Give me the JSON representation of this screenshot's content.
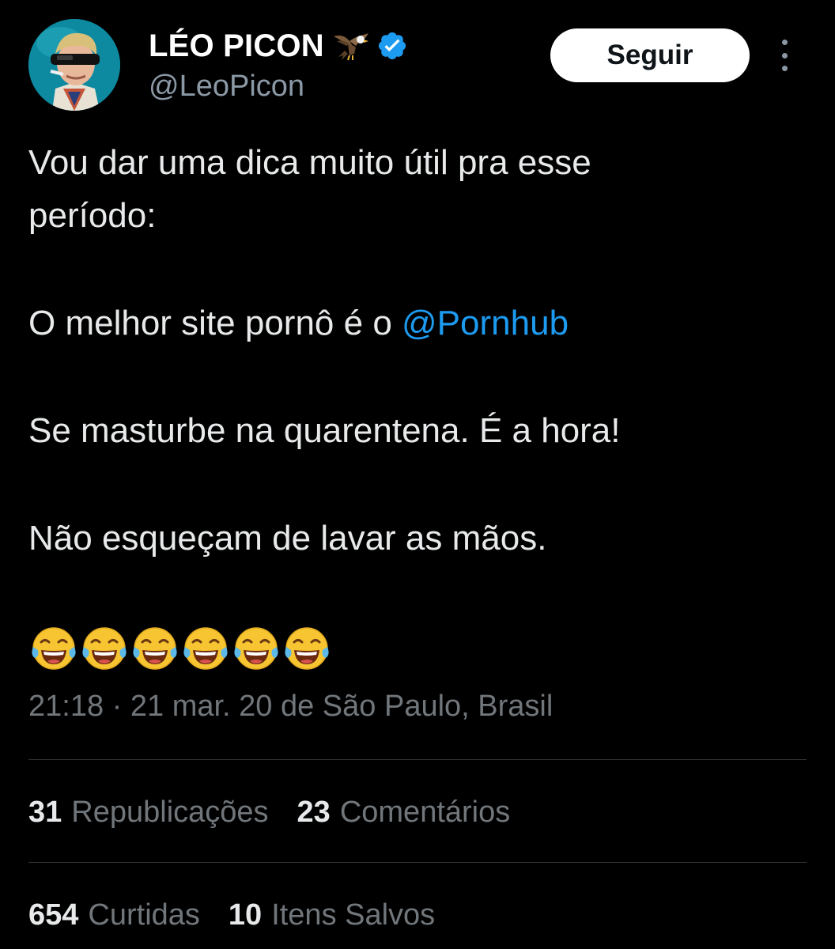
{
  "author": {
    "display_name": "LÉO PICON",
    "handle": "@LeoPicon",
    "badge_emoji": "eagle-icon",
    "verified": true,
    "verified_color": "#1d9bf0"
  },
  "follow_button": {
    "label": "Seguir"
  },
  "tweet": {
    "line1": "Vou dar uma dica muito útil pra esse",
    "line2": "período:",
    "line3_text": "O melhor site pornô é o ",
    "line3_mention": "@Pornhub",
    "line4": "Se masturbe na quarentena. É a hora!",
    "line5": "Não esqueçam de lavar as mãos.",
    "emoji": "😂😂😂😂😂😂",
    "emoji_count": 6
  },
  "timestamp": "21:18 · 21 mar. 20 de São Paulo, Brasil",
  "stats": {
    "reposts_count": "31",
    "reposts_label": "Republicações",
    "comments_count": "23",
    "comments_label": "Comentários",
    "likes_count": "654",
    "likes_label": "Curtidas",
    "saves_count": "10",
    "saves_label": "Itens Salvos"
  },
  "colors": {
    "background": "#000000",
    "text": "#e7e9ea",
    "secondary": "#71767b",
    "accent": "#1d9bf0",
    "divider": "#2f3336"
  }
}
